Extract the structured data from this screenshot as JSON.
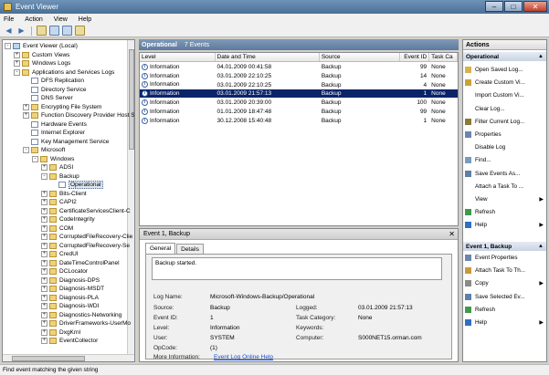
{
  "window": {
    "title": "Event Viewer",
    "min": "–",
    "max": "□",
    "close": "✕"
  },
  "menu": [
    "File",
    "Action",
    "View",
    "Help"
  ],
  "toolbar": [
    "back-icon",
    "forward-icon",
    "folder-up-icon",
    "properties-icon",
    "help-icon",
    "pane-icon"
  ],
  "tree": [
    {
      "label": "Event Viewer (Local)",
      "depth": 0,
      "exp": "-",
      "icon": "pc"
    },
    {
      "label": "Custom Views",
      "depth": 1,
      "exp": "+",
      "icon": "folder"
    },
    {
      "label": "Windows Logs",
      "depth": 1,
      "exp": "+",
      "icon": "folder"
    },
    {
      "label": "Applications and Services Logs",
      "depth": 1,
      "exp": "-",
      "icon": "folder"
    },
    {
      "label": "DFS Replication",
      "depth": 2,
      "exp": "",
      "icon": "log"
    },
    {
      "label": "Directory Service",
      "depth": 2,
      "exp": "",
      "icon": "log"
    },
    {
      "label": "DNS Server",
      "depth": 2,
      "exp": "",
      "icon": "log"
    },
    {
      "label": "Encrypting File System",
      "depth": 2,
      "exp": "+",
      "icon": "folder"
    },
    {
      "label": "Function Discovery Provider Host S",
      "depth": 2,
      "exp": "+",
      "icon": "folder"
    },
    {
      "label": "Hardware Events",
      "depth": 2,
      "exp": "",
      "icon": "log"
    },
    {
      "label": "Internet Explorer",
      "depth": 2,
      "exp": "",
      "icon": "log"
    },
    {
      "label": "Key Management Service",
      "depth": 2,
      "exp": "",
      "icon": "log"
    },
    {
      "label": "Microsoft",
      "depth": 2,
      "exp": "-",
      "icon": "folder"
    },
    {
      "label": "Windows",
      "depth": 3,
      "exp": "-",
      "icon": "folder"
    },
    {
      "label": "ADSI",
      "depth": 4,
      "exp": "+",
      "icon": "folder"
    },
    {
      "label": "Backup",
      "depth": 4,
      "exp": "-",
      "icon": "folder"
    },
    {
      "label": "Operational",
      "depth": 5,
      "exp": "",
      "icon": "log",
      "selected": true
    },
    {
      "label": "Bits-Client",
      "depth": 4,
      "exp": "+",
      "icon": "folder"
    },
    {
      "label": "CAPI2",
      "depth": 4,
      "exp": "+",
      "icon": "folder"
    },
    {
      "label": "CertificateServicesClient-C",
      "depth": 4,
      "exp": "+",
      "icon": "folder"
    },
    {
      "label": "CodeIntegrity",
      "depth": 4,
      "exp": "+",
      "icon": "folder"
    },
    {
      "label": "COM",
      "depth": 4,
      "exp": "+",
      "icon": "folder"
    },
    {
      "label": "CorruptedFileRecovery-Clie",
      "depth": 4,
      "exp": "+",
      "icon": "folder"
    },
    {
      "label": "CorruptedFileRecovery-Se",
      "depth": 4,
      "exp": "+",
      "icon": "folder"
    },
    {
      "label": "CredUI",
      "depth": 4,
      "exp": "+",
      "icon": "folder"
    },
    {
      "label": "DateTimeControlPanel",
      "depth": 4,
      "exp": "+",
      "icon": "folder"
    },
    {
      "label": "DCLocator",
      "depth": 4,
      "exp": "+",
      "icon": "folder"
    },
    {
      "label": "Diagnosis-DPS",
      "depth": 4,
      "exp": "+",
      "icon": "folder"
    },
    {
      "label": "Diagnosis-MSDT",
      "depth": 4,
      "exp": "+",
      "icon": "folder"
    },
    {
      "label": "Diagnosis-PLA",
      "depth": 4,
      "exp": "+",
      "icon": "folder"
    },
    {
      "label": "Diagnosis-WDI",
      "depth": 4,
      "exp": "+",
      "icon": "folder"
    },
    {
      "label": "Diagnostics-Networking",
      "depth": 4,
      "exp": "+",
      "icon": "folder"
    },
    {
      "label": "DriverFrameworks-UserMo",
      "depth": 4,
      "exp": "+",
      "icon": "folder"
    },
    {
      "label": "DxgKrnl",
      "depth": 4,
      "exp": "+",
      "icon": "folder"
    },
    {
      "label": "EventCollector",
      "depth": 4,
      "exp": "+",
      "icon": "folder"
    }
  ],
  "log": {
    "name": "Operational",
    "count": "7 Events",
    "columns": [
      "Level",
      "Date and Time",
      "Source",
      "Event ID",
      "Task Ca"
    ],
    "events": [
      {
        "level": "Information",
        "date": "04.01.2009 00:41:58",
        "source": "Backup",
        "id": "99",
        "task": "None"
      },
      {
        "level": "Information",
        "date": "03.01.2009 22:10:25",
        "source": "Backup",
        "id": "14",
        "task": "None"
      },
      {
        "level": "Information",
        "date": "03.01.2009 22:10:25",
        "source": "Backup",
        "id": "4",
        "task": "None"
      },
      {
        "level": "Information",
        "date": "03.01.2009 21:57:13",
        "source": "Backup",
        "id": "1",
        "task": "None",
        "selected": true
      },
      {
        "level": "Information",
        "date": "03.01.2009 20:39:00",
        "source": "Backup",
        "id": "100",
        "task": "None"
      },
      {
        "level": "Information",
        "date": "01.01.2009 18:47:48",
        "source": "Backup",
        "id": "99",
        "task": "None"
      },
      {
        "level": "Information",
        "date": "30.12.2008 15:40:48",
        "source": "Backup",
        "id": "1",
        "task": "None"
      }
    ]
  },
  "detail": {
    "title": "Event 1, Backup",
    "close": "✕",
    "tabs": [
      "General",
      "Details"
    ],
    "message": "Backup started.",
    "labels": {
      "log_name": "Log Name:",
      "source": "Source:",
      "event_id": "Event ID:",
      "level": "Level:",
      "user": "User:",
      "opcode": "OpCode:",
      "more_info": "More Information:",
      "logged": "Logged:",
      "task_category": "Task Category:",
      "keywords": "Keywords:",
      "computer": "Computer:"
    },
    "values": {
      "log_name": "Microsoft-Windows-Backup/Operational",
      "source": "Backup",
      "event_id": "1",
      "level": "Information",
      "user": "SYSTEM",
      "opcode": "(1)",
      "more_info": "Event Log Online Help",
      "logged": "03.01.2009 21:57:13",
      "task_category": "None",
      "keywords": "",
      "computer": "S000NET15.orman.com"
    }
  },
  "actions": {
    "title": "Actions",
    "section1": "Operational",
    "items1": [
      {
        "label": "Open Saved Log...",
        "icon": "open-log-icon",
        "color": "#d8b24a"
      },
      {
        "label": "Create Custom Vi...",
        "icon": "filter-create-icon",
        "color": "#c8a13a"
      },
      {
        "label": "Import Custom Vi...",
        "icon": "import-icon",
        "color": ""
      },
      {
        "label": "Clear Log...",
        "icon": "clear-icon",
        "color": ""
      },
      {
        "label": "Filter Current Log...",
        "icon": "filter-icon",
        "color": "#8a7b3a"
      },
      {
        "label": "Properties",
        "icon": "properties-icon",
        "color": "#6a86b0"
      },
      {
        "label": "Disable Log",
        "icon": "disable-icon",
        "color": ""
      },
      {
        "label": "Find...",
        "icon": "find-icon",
        "color": "#7a9ac0"
      },
      {
        "label": "Save Events As...",
        "icon": "save-icon",
        "color": "#5f7fa8"
      },
      {
        "label": "Attach a Task To ...",
        "icon": "task-icon",
        "color": ""
      },
      {
        "label": "View",
        "icon": "view-icon",
        "color": "",
        "arrow": true
      },
      {
        "label": "Refresh",
        "icon": "refresh-icon",
        "color": "#3f9a4a"
      },
      {
        "label": "Help",
        "icon": "help-icon",
        "color": "#2f6fc0",
        "arrow": true
      }
    ],
    "section2": "Event 1, Backup",
    "items2": [
      {
        "label": "Event Properties",
        "icon": "event-properties-icon",
        "color": "#6a86b0"
      },
      {
        "label": "Attach Task To Th...",
        "icon": "attach-task-icon",
        "color": "#c89a3a"
      },
      {
        "label": "Copy",
        "icon": "copy-icon",
        "color": "#8a8a8a",
        "arrow": true
      },
      {
        "label": "Save Selected Ev...",
        "icon": "save-selected-icon",
        "color": "#5f7fa8"
      },
      {
        "label": "Refresh",
        "icon": "refresh-icon",
        "color": "#3f9a4a"
      },
      {
        "label": "Help",
        "icon": "help-icon",
        "color": "#2f6fc0",
        "arrow": true
      }
    ]
  },
  "status": "Find event matching the given string"
}
